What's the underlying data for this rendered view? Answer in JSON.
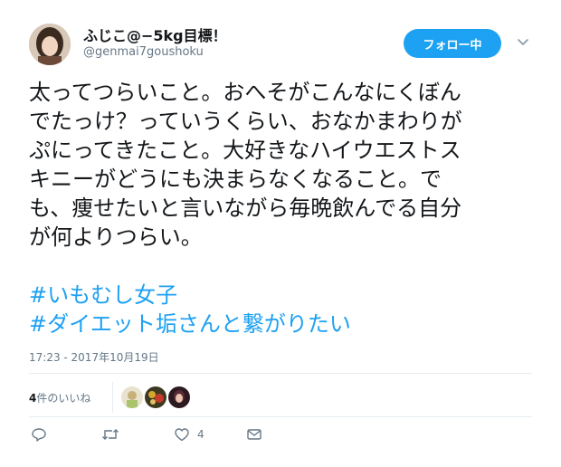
{
  "author": {
    "display_name": "ふじこ@−5kg目標！",
    "handle": "@genmai7goushoku"
  },
  "follow_button": {
    "label": "フォロー中"
  },
  "tweet": {
    "lines": [
      "太ってつらいこと。おへそがこんなにくぼん",
      "でたっけ？っていうくらい、おなかまわりが",
      "ぷにってきたこと。大好きなハイウエストス",
      "キニーがどうにも決まらなくなること。で",
      "も、痩せたいと言いながら毎晩飲んでる自分",
      "が何よりつらい。"
    ],
    "hashtags": [
      "#いもむし女子",
      "#ダイエット垢さんと繋がりたい"
    ],
    "timestamp": "17:23 - 2017年10月19日"
  },
  "stats": {
    "likes_number": "4",
    "likes_unit": "件のいいね"
  },
  "actions": {
    "reply_icon": "reply-icon",
    "retweet_icon": "retweet-icon",
    "like_icon": "heart-icon",
    "like_count": "4",
    "dm_icon": "envelope-icon"
  },
  "colors": {
    "accent": "#1da1f2",
    "text": "#14171a",
    "muted": "#657786",
    "divider": "#e6ecf0"
  }
}
